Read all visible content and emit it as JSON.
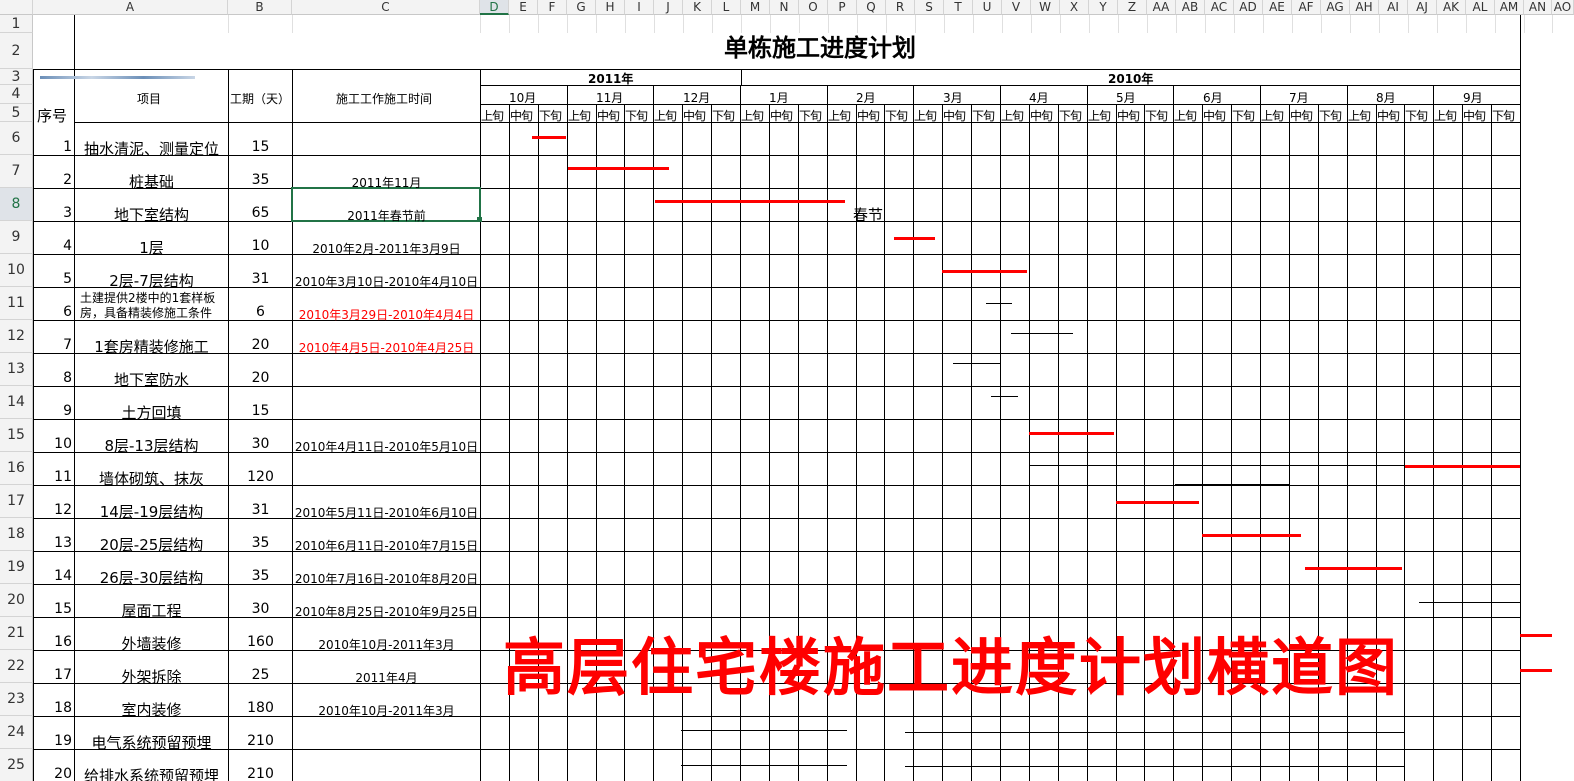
{
  "title": "单栋施工进度计划",
  "headers": {
    "seq": "序号",
    "item": "项目",
    "period": "工期（天）",
    "time": "施工工作施工时间"
  },
  "columns": [
    "A",
    "B",
    "C",
    "D",
    "E",
    "F",
    "G",
    "H",
    "I",
    "J",
    "K",
    "L",
    "M",
    "N",
    "O",
    "P",
    "Q",
    "R",
    "S",
    "T",
    "U",
    "V",
    "W",
    "X",
    "Y",
    "Z",
    "AA",
    "AB",
    "AC",
    "AD",
    "AE",
    "AF",
    "AG",
    "AH",
    "AI",
    "AJ",
    "AK",
    "AL",
    "AM",
    "AN",
    "AO"
  ],
  "selected_column": "D",
  "selected_row": 8,
  "years": [
    {
      "label": "2011年"
    },
    {
      "label": "2010年"
    }
  ],
  "months": [
    "10月",
    "11月",
    "12月",
    "1月",
    "2月",
    "3月",
    "4月",
    "5月",
    "6月",
    "7月",
    "8月",
    "9月"
  ],
  "periods": [
    "上旬",
    "中旬",
    "下旬"
  ],
  "rows": [
    {
      "n": "1",
      "item": "抽水清泥、测量定位",
      "days": "15",
      "time": ""
    },
    {
      "n": "2",
      "item": "桩基础",
      "days": "35",
      "time": "2011年11月"
    },
    {
      "n": "3",
      "item": "地下室结构",
      "days": "65",
      "time": "2011年春节前"
    },
    {
      "n": "4",
      "item": "1层",
      "days": "10",
      "time": "2010年2月-2011年3月9日"
    },
    {
      "n": "5",
      "item": "2层-7层结构",
      "days": "31",
      "time": "2010年3月10日-2010年4月10日"
    },
    {
      "n": "6",
      "item": "土建提供2楼中的1套样板房，具备精装修施工条件",
      "item_lines": [
        "土建提供2楼中的1套样板",
        "房，具备精装修施工条件"
      ],
      "days": "6",
      "time": "2010年3月29日-2010年4月4日",
      "time_color": "#ff0000"
    },
    {
      "n": "7",
      "item": "1套房精装修施工",
      "days": "20",
      "time": "2010年4月5日-2010年4月25日",
      "time_color": "#ff0000"
    },
    {
      "n": "8",
      "item": "地下室防水",
      "days": "20",
      "time": ""
    },
    {
      "n": "9",
      "item": "土方回填",
      "days": "15",
      "time": ""
    },
    {
      "n": "10",
      "item": "8层-13层结构",
      "days": "30",
      "time": "2010年4月11日-2010年5月10日"
    },
    {
      "n": "11",
      "item": "墙体砌筑、抹灰",
      "days": "120",
      "time": ""
    },
    {
      "n": "12",
      "item": "14层-19层结构",
      "days": "31",
      "time": "2010年5月11日-2010年6月10日"
    },
    {
      "n": "13",
      "item": "20层-25层结构",
      "days": "35",
      "time": "2010年6月11日-2010年7月15日"
    },
    {
      "n": "14",
      "item": "26层-30层结构",
      "days": "35",
      "time": "2010年7月16日-2010年8月20日"
    },
    {
      "n": "15",
      "item": "屋面工程",
      "days": "30",
      "time": "2010年8月25日-2010年9月25日"
    },
    {
      "n": "16",
      "item": "外墙装修",
      "days": "160",
      "time": "2010年10月-2011年3月"
    },
    {
      "n": "17",
      "item": "外架拆除",
      "days": "25",
      "time": "2011年4月"
    },
    {
      "n": "18",
      "item": "室内装修",
      "days": "180",
      "time": "2010年10月-2011年3月"
    },
    {
      "n": "19",
      "item": "电气系统预留预埋",
      "days": "210",
      "time": ""
    },
    {
      "n": "20",
      "item": "给排水系统预留预埋",
      "days": "210",
      "time": ""
    }
  ],
  "annotation": "春节",
  "watermark": "高层住宅楼施工进度计划横道图",
  "colors": {
    "red": "#ff0000",
    "grid": "#000000",
    "accent": "#217346"
  }
}
